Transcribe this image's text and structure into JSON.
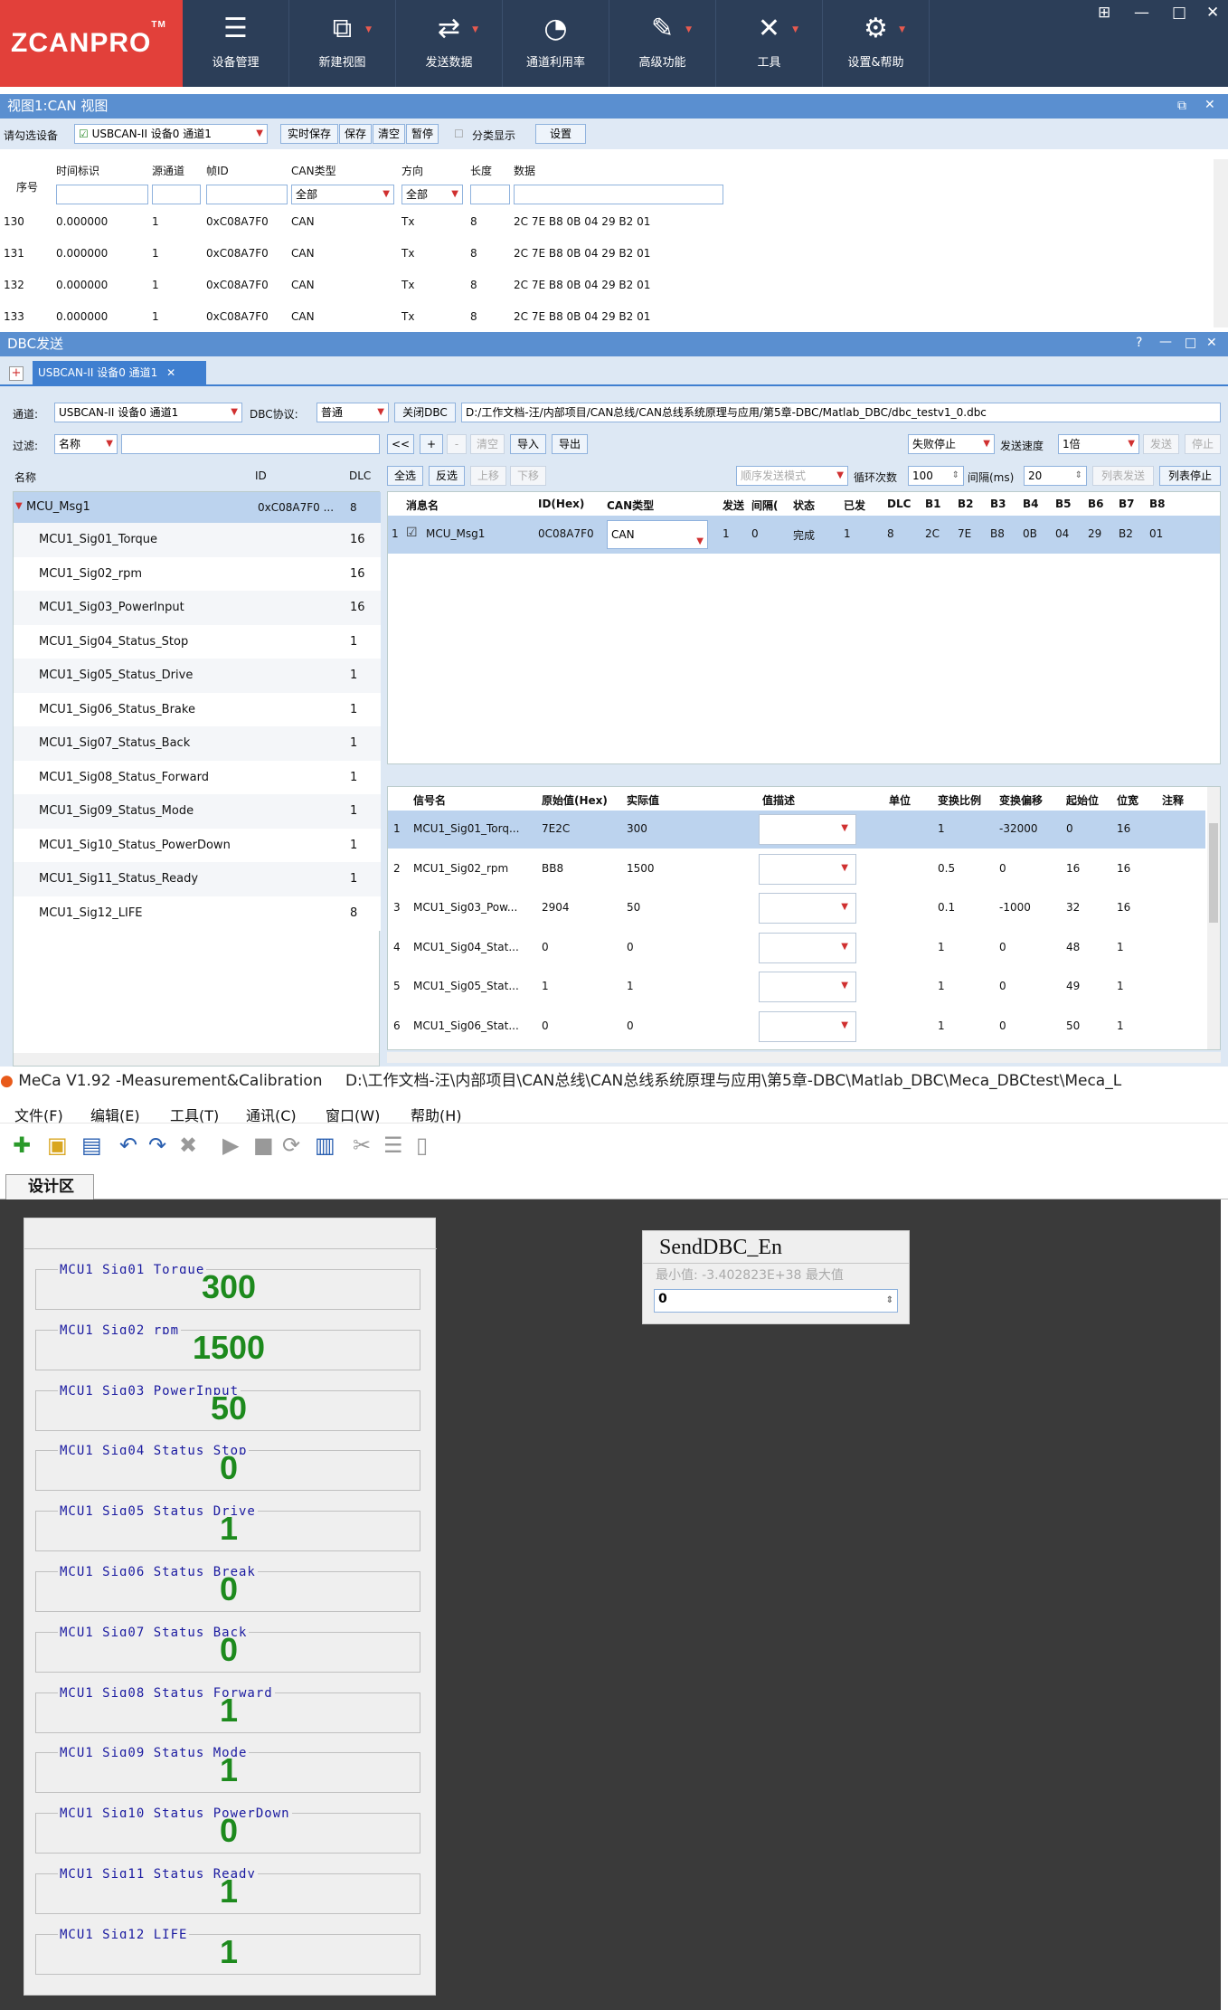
{
  "app": {
    "logo": "ZCANPRO",
    "logo_tm": "TM"
  },
  "ribbon": [
    {
      "label": "设备管理",
      "icon": "device-list-gear-icon"
    },
    {
      "label": "新建视图",
      "icon": "new-view-icon"
    },
    {
      "label": "发送数据",
      "icon": "send-data-icon"
    },
    {
      "label": "通道利用率",
      "icon": "channel-usage-icon"
    },
    {
      "label": "高级功能",
      "icon": "advanced-icon"
    },
    {
      "label": "工具",
      "icon": "tools-icon"
    },
    {
      "label": "设置&帮助",
      "icon": "settings-gear-icon"
    }
  ],
  "can_view": {
    "title": "视图1:CAN 视图",
    "device_label": "请勾选设备",
    "device_value": "USBCAN-II 设备0 通道1",
    "buttons": [
      "实时保存",
      "保存",
      "清空",
      "暂停"
    ],
    "group_label": "分类显示",
    "settings": "设置",
    "columns": [
      "序号",
      "时间标识",
      "源通道",
      "帧ID",
      "CAN类型",
      "方向",
      "长度",
      "数据"
    ],
    "filter_type": "全部",
    "filter_dir": "全部",
    "rows": [
      [
        "130",
        "0.000000",
        "1",
        "0xC08A7F0",
        "CAN",
        "Tx",
        "8",
        "2C 7E B8 0B 04 29 B2 01"
      ],
      [
        "131",
        "0.000000",
        "1",
        "0xC08A7F0",
        "CAN",
        "Tx",
        "8",
        "2C 7E B8 0B 04 29 B2 01"
      ],
      [
        "132",
        "0.000000",
        "1",
        "0xC08A7F0",
        "CAN",
        "Tx",
        "8",
        "2C 7E B8 0B 04 29 B2 01"
      ],
      [
        "133",
        "0.000000",
        "1",
        "0xC08A7F0",
        "CAN",
        "Tx",
        "8",
        "2C 7E B8 0B 04 29 B2 01"
      ]
    ]
  },
  "dbc": {
    "title": "DBC发送",
    "tab": "USBCAN-II 设备0 通道1",
    "channel_label": "通道:",
    "channel_value": "USBCAN-II 设备0 通道1",
    "protocol_label": "DBC协议:",
    "protocol_value": "普通",
    "close_btn": "关闭DBC",
    "path": "D:/工作文档-汪/内部项目/CAN总线/CAN总线系统原理与应用/第5章-DBC/Matlab_DBC/dbc_testv1_0.dbc",
    "filter_label": "过滤:",
    "filter_value": "名称",
    "btns_row1": [
      "<<",
      "+",
      "-",
      "清空",
      "导入",
      "导出"
    ],
    "fail_stop": "失败停止",
    "speed_label": "发送速度",
    "speed_value": "1倍",
    "send": "发送",
    "stop": "停止",
    "btns_row2": [
      "全选",
      "反选",
      "上移",
      "下移"
    ],
    "mode": "顺序发送模式",
    "loop_label": "循环次数",
    "loop_value": "100",
    "interval_label": "间隔(ms)",
    "interval_value": "20",
    "list_send": "列表发送",
    "list_stop": "列表停止",
    "tree_cols": [
      "名称",
      "ID",
      "DLC"
    ],
    "msg": {
      "name": "MCU_Msg1",
      "id": "0xC08A7F0 ...",
      "dlc": "8"
    },
    "signals": [
      {
        "name": "MCU1_Sig01_Torque",
        "dlc": "16"
      },
      {
        "name": "MCU1_Sig02_rpm",
        "dlc": "16"
      },
      {
        "name": "MCU1_Sig03_PowerInput",
        "dlc": "16"
      },
      {
        "name": "MCU1_Sig04_Status_Stop",
        "dlc": "1"
      },
      {
        "name": "MCU1_Sig05_Status_Drive",
        "dlc": "1"
      },
      {
        "name": "MCU1_Sig06_Status_Brake",
        "dlc": "1"
      },
      {
        "name": "MCU1_Sig07_Status_Back",
        "dlc": "1"
      },
      {
        "name": "MCU1_Sig08_Status_Forward",
        "dlc": "1"
      },
      {
        "name": "MCU1_Sig09_Status_Mode",
        "dlc": "1"
      },
      {
        "name": "MCU1_Sig10_Status_PowerDown",
        "dlc": "1"
      },
      {
        "name": "MCU1_Sig11_Status_Ready",
        "dlc": "1"
      },
      {
        "name": "MCU1_Sig12_LIFE",
        "dlc": "8"
      }
    ],
    "msg_cols": [
      "消息名",
      "ID(Hex)",
      "CAN类型",
      "发送",
      "间隔(",
      "状态",
      "已发",
      "DLC",
      "B1",
      "B2",
      "B3",
      "B4",
      "B5",
      "B6",
      "B7",
      "B8"
    ],
    "msg_row": [
      "1",
      "MCU_Msg1",
      "0C08A7F0",
      "CAN",
      "1",
      "0",
      "完成",
      "1",
      "8",
      "2C",
      "7E",
      "B8",
      "0B",
      "04",
      "29",
      "B2",
      "01"
    ],
    "sig_cols": [
      "信号名",
      "原始值(Hex)",
      "实际值",
      "值描述",
      "单位",
      "变换比例",
      "变换偏移",
      "起始位",
      "位宽",
      "注释"
    ],
    "sig_rows": [
      [
        "1",
        "MCU1_Sig01_Torq...",
        "7E2C",
        "300",
        "",
        "1",
        "-32000",
        "0",
        "16"
      ],
      [
        "2",
        "MCU1_Sig02_rpm",
        "BB8",
        "1500",
        "",
        "0.5",
        "0",
        "16",
        "16"
      ],
      [
        "3",
        "MCU1_Sig03_Pow...",
        "2904",
        "50",
        "",
        "0.1",
        "-1000",
        "32",
        "16"
      ],
      [
        "4",
        "MCU1_Sig04_Stat...",
        "0",
        "0",
        "",
        "1",
        "0",
        "48",
        "1"
      ],
      [
        "5",
        "MCU1_Sig05_Stat...",
        "1",
        "1",
        "",
        "1",
        "0",
        "49",
        "1"
      ],
      [
        "6",
        "MCU1_Sig06_Stat...",
        "0",
        "0",
        "",
        "1",
        "0",
        "50",
        "1"
      ]
    ]
  },
  "meca": {
    "title": "MeCa V1.92 -Measurement&Calibration",
    "path": "D:\\工作文档-汪\\内部项目\\CAN总线\\CAN总线系统原理与应用\\第5章-DBC\\Matlab_DBC\\Meca_DBCtest\\Meca_L",
    "menu": [
      "文件(F)",
      "编辑(E)",
      "工具(T)",
      "通讯(C)",
      "窗口(W)",
      "帮助(H)"
    ],
    "tab": "设计区",
    "gauges": [
      {
        "label": "MCU1_Sig01_Torque",
        "value": "300"
      },
      {
        "label": "MCU1_Sig02_rpm",
        "value": "1500"
      },
      {
        "label": "MCU1_Sig03_PowerInput",
        "value": "50"
      },
      {
        "label": "MCU1_Sig04_Status_Stop",
        "value": "0"
      },
      {
        "label": "MCU1_Sig05_Status_Drive",
        "value": "1"
      },
      {
        "label": "MCU1_Sig06_Status_Break",
        "value": "0"
      },
      {
        "label": "MCU1_Sig07_Status_Back",
        "value": "0"
      },
      {
        "label": "MCU1_Sig08_Status_Forward",
        "value": "1"
      },
      {
        "label": "MCU1_Sig09_Status_Mode",
        "value": "1"
      },
      {
        "label": "MCU1_Sig10_Status_PowerDown",
        "value": "0"
      },
      {
        "label": "MCU1_Sig11_Status_Ready",
        "value": "1"
      },
      {
        "label": "MCU1_Sig12_LIFE",
        "value": "1"
      }
    ],
    "send_panel": {
      "title": "SendDBC_En",
      "hint": "最小值: -3.402823E+38 最大值",
      "value": "0"
    }
  }
}
